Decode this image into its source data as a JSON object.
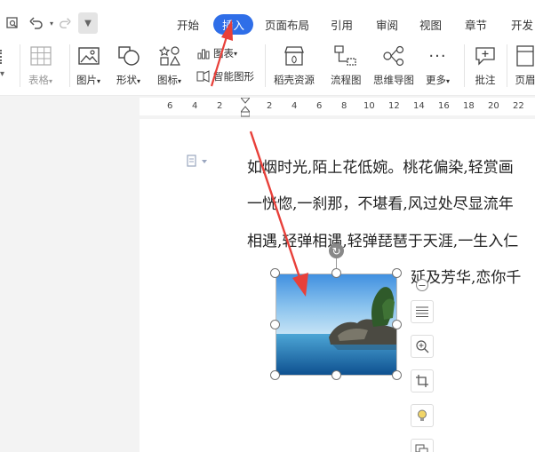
{
  "quick_access": {
    "print_preview_icon": "print-preview-icon",
    "undo_icon": "undo-icon",
    "redo_icon": "redo-icon",
    "customize_icon": "customize-dropdown-icon"
  },
  "tabs": [
    {
      "label": "开始"
    },
    {
      "label": "插入"
    },
    {
      "label": "页面布局"
    },
    {
      "label": "引用"
    },
    {
      "label": "审阅"
    },
    {
      "label": "视图"
    },
    {
      "label": "章节"
    },
    {
      "label": "开发"
    }
  ],
  "active_tab": "插入",
  "ribbon": {
    "table": "表格",
    "picture": "图片",
    "shape": "形状",
    "icon": "图标",
    "chart": "图表",
    "smart_shape": "智能图形",
    "daoke_resource": "稻壳资源",
    "flowchart": "流程图",
    "mindmap": "思维导图",
    "more": "更多",
    "comment": "批注",
    "header": "页眉"
  },
  "ruler": [
    "6",
    "4",
    "2",
    "2",
    "4",
    "6",
    "8",
    "10",
    "12",
    "14",
    "16",
    "18",
    "20",
    "22"
  ],
  "document": {
    "line1": "如烟时光,陌上花低婉。桃花偏染,轻赏画",
    "line2": "一恍惚,一刹那，不堪看,风过处尽显流年",
    "line3": "相遇,轻弹相遇,轻弹琵琶于天涯,一生入仁",
    "line4": "延及芳华,恋你千"
  },
  "colors": {
    "accent": "#2f6ee8",
    "arrow": "#e8403a"
  }
}
